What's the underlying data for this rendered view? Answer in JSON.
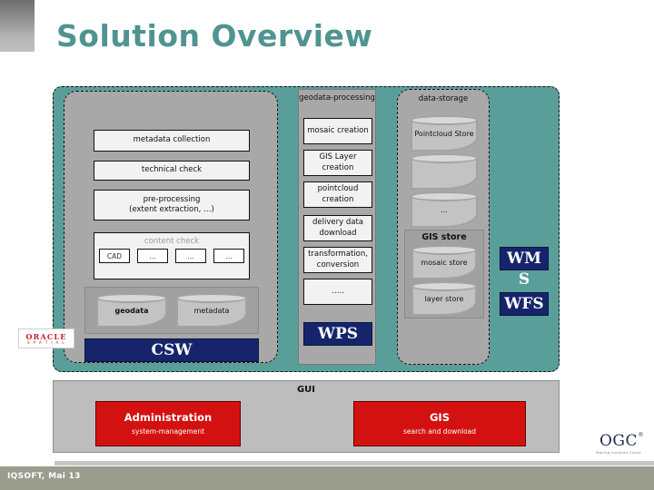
{
  "slide": {
    "title": "Solution Overview",
    "footer": "IQSOFT, Mai 13"
  },
  "colors": {
    "teal": "#5a9e9a",
    "title_teal": "#4f9490",
    "navy": "#16256b",
    "red": "#d41111",
    "gray_panel": "#a8a8a8",
    "footer_bar": "#9a9c8e"
  },
  "metadata_column": {
    "boxes": [
      {
        "label": "metadata collection"
      },
      {
        "label": "technical check"
      },
      {
        "label": "pre-processing\n(extent extraction, …)"
      }
    ],
    "content_check": {
      "title": "content check",
      "chips": [
        "CAD",
        "…",
        "…",
        "…"
      ]
    },
    "databases": [
      {
        "label": "geodata",
        "bold": true
      },
      {
        "label": "metadata",
        "bold": false
      }
    ],
    "service": "CSW"
  },
  "processing_column": {
    "title": "geodata-processing",
    "boxes": [
      {
        "label": "mosaic creation"
      },
      {
        "label": "GIS Layer creation"
      },
      {
        "label": "pointcloud creation"
      },
      {
        "label": "delivery data download"
      },
      {
        "label": "transformation, conversion"
      },
      {
        "label": "….."
      }
    ],
    "service": "WPS"
  },
  "storage_column": {
    "title": "data-storage",
    "stores": [
      {
        "label": "Pointcloud Store"
      },
      {
        "label": ""
      },
      {
        "label": "…"
      }
    ],
    "gis_store": {
      "title": "GIS store",
      "stores": [
        {
          "label": "mosaic store"
        },
        {
          "label": "layer store"
        }
      ]
    },
    "vendor_logo": {
      "name": "ORACLE",
      "sub": "S P A T I A L"
    }
  },
  "ogc_services": {
    "wms_visible": "WM",
    "wms_overflow": "S",
    "wfs": "WFS"
  },
  "gui_panel": {
    "title": "GUI",
    "boxes": [
      {
        "title": "Administration",
        "subtitle": "system-management"
      },
      {
        "title": "GIS",
        "subtitle": "search and download"
      }
    ]
  },
  "ogc_logo": {
    "word": "OGC",
    "sup": "®",
    "sub": "Making Location Count"
  }
}
